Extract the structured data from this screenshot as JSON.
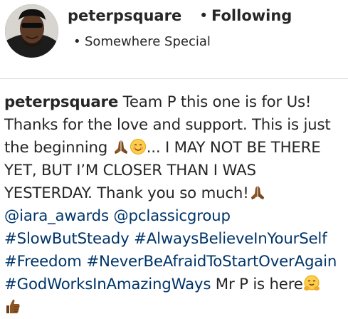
{
  "post": {
    "username": "peterpsquare",
    "follow_separator": "•",
    "follow_status": "Following",
    "location_separator": "•",
    "location": "Somewhere Special"
  },
  "caption": {
    "username": "peterpsquare",
    "line1_text": " Team P this one is for Us!",
    "line2_text": "Thanks for the love and support. This is just",
    "line3_text_a": "the beginning ",
    "line3_text_b": "... I MAY NOT BE THERE",
    "line4_text": "YET, BUT I’M CLOSER THAN I WAS",
    "line5_text": "YESTERDAY. Thank you so much!",
    "mention1": "@iara_awards",
    "mention_sep": " ",
    "mention2": "@pclassicgroup",
    "hashtag1": "#SlowButSteady",
    "hashtag_sep1": " ",
    "hashtag2": "#AlwaysBelieveInYourSelf",
    "hashtag3": "#Freedom",
    "hashtag_sep2": " ",
    "hashtag4": "#NeverBeAfraidToStartOverAgain",
    "hashtag5": "#GodWorksInAmazingWays",
    "line9_text": " Mr P is here"
  },
  "emojis": {
    "line3": [
      "folded-hands-icon",
      "smiling-face-icon"
    ],
    "line5": [
      "folded-hands-icon"
    ],
    "line9": [
      "hugging-face-icon"
    ],
    "line10": [
      "thumbs-up-icon"
    ]
  },
  "colors": {
    "text": "#262626",
    "link": "#003569",
    "divider": "#dbdbdb",
    "skin_tone": "#8d5524",
    "emoji_yellow": "#ffcc4d"
  }
}
